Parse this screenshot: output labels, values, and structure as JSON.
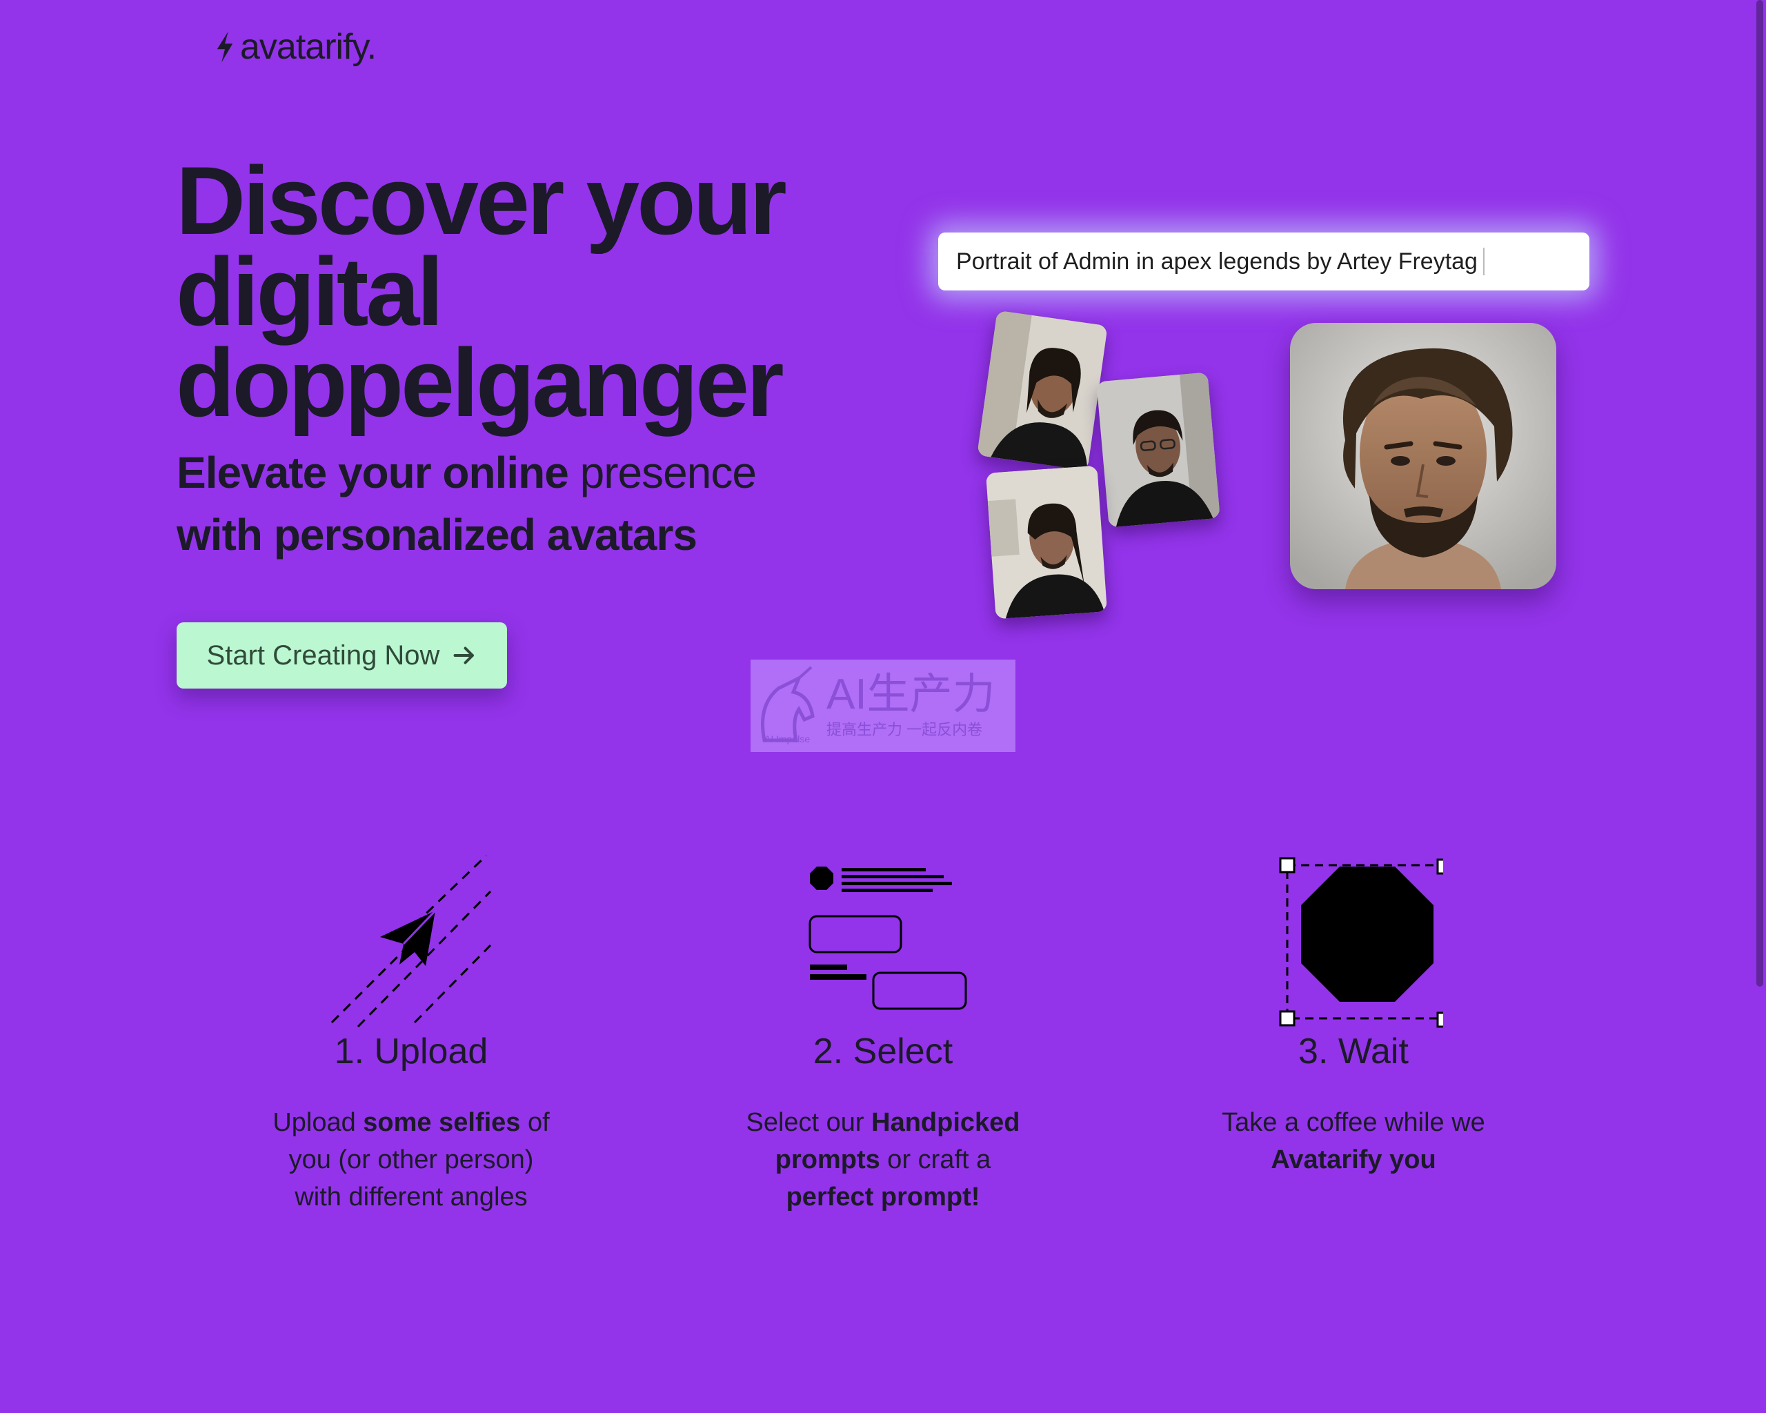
{
  "brand": {
    "name": "avatarify.",
    "icon": "bolt-icon"
  },
  "hero": {
    "title_line1": "Discover your",
    "title_line2": "digital",
    "title_line3": "doppelganger",
    "subtitle_bold1": "Elevate your online",
    "subtitle_light": "presence",
    "subtitle_bold2": "with personalized avatars",
    "cta_label": "Start Creating Now",
    "cta_icon": "arrow-right-icon"
  },
  "demo": {
    "prompt_text": "Portrait of Admin in apex legends by Artey Freytag"
  },
  "watermark": {
    "main": "AI生产力",
    "sub": "提高生产力 一起反内卷",
    "tiny": "AI Impulse"
  },
  "steps": [
    {
      "icon": "paper-plane-icon",
      "title": "1. Upload",
      "line_a": "Upload ",
      "line_b": "some selfies",
      "line_c": " of",
      "line_d": "you (or other person)",
      "line_e": "with different angles"
    },
    {
      "icon": "layout-select-icon",
      "title": "2. Select",
      "line_a": "Select our ",
      "line_b": "Handpicked",
      "line_c": "prompts",
      "line_d": " or craft a",
      "line_e": "perfect prompt!"
    },
    {
      "icon": "octagon-selection-icon",
      "title": "3. Wait",
      "line_a": "Take a coffee while we",
      "line_b": "Avatarify you"
    }
  ],
  "colors": {
    "background": "#9333ea",
    "text": "#1c1a28",
    "cta_bg": "#bbf7d0"
  }
}
